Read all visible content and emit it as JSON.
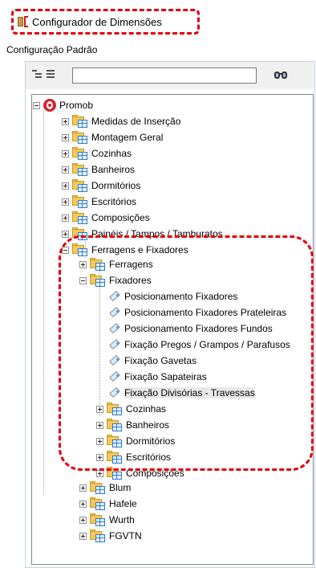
{
  "window": {
    "title": "Configurador de Dimensões",
    "title_icon": "dimension-configurator-icon"
  },
  "subtitle": "Configuração Padrão",
  "toolbar": {
    "search_value": "",
    "expand_all_icon": "expand-all-icon",
    "collapse_all_icon": "collapse-all-icon",
    "find_icon": "binoculars-icon"
  },
  "tree": {
    "root": "Promob",
    "items": [
      {
        "label": "Medidas de Inserção"
      },
      {
        "label": "Montagem Geral"
      },
      {
        "label": "Cozinhas"
      },
      {
        "label": "Banheiros"
      },
      {
        "label": "Dormitórios"
      },
      {
        "label": "Escritórios"
      },
      {
        "label": "Composições"
      },
      {
        "label": "Painéis / Tampos / Tamburatos"
      },
      {
        "label": "Ferragens e Fixadores"
      },
      {
        "label": "Ferragens"
      },
      {
        "label": "Fixadores"
      },
      {
        "label": "Posicionamento Fixadores"
      },
      {
        "label": "Posicionamento Fixadores Prateleiras"
      },
      {
        "label": "Posicionamento Fixadores Fundos"
      },
      {
        "label": "Fixação Pregos / Grampos / Parafusos"
      },
      {
        "label": "Fixação Gavetas"
      },
      {
        "label": "Fixação Sapateiras"
      },
      {
        "label": "Fixação Divisórias - Travessas"
      },
      {
        "label": "Cozinhas"
      },
      {
        "label": "Banheiros"
      },
      {
        "label": "Dormitórios"
      },
      {
        "label": "Escritórios"
      },
      {
        "label": "Composições"
      },
      {
        "label": "Blum"
      },
      {
        "label": "Hafele"
      },
      {
        "label": "Wurth"
      },
      {
        "label": "FGVTN"
      }
    ]
  },
  "colors": {
    "highlight_dash": "#e0000f",
    "folder": "#f7c857",
    "selected_row": "#e9e9e9"
  }
}
